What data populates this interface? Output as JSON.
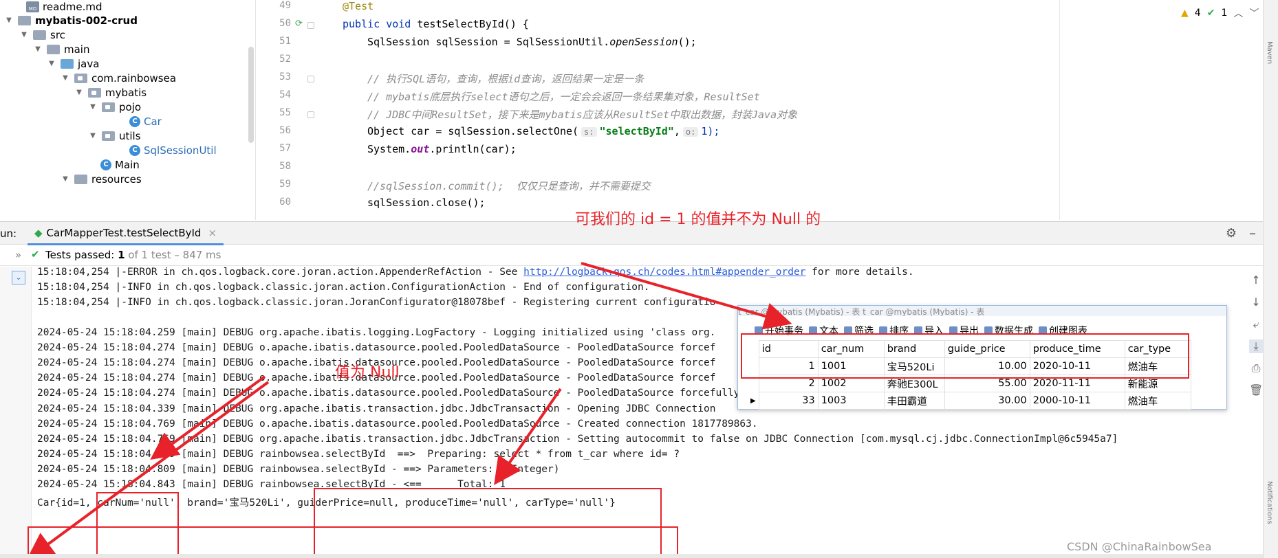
{
  "tree": {
    "readme": "readme.md",
    "module": "mybatis-002-crud",
    "src": "src",
    "main": "main",
    "java": "java",
    "pkg": "com.rainbowsea",
    "mybatis": "mybatis",
    "pojo": "pojo",
    "car": "Car",
    "utils": "utils",
    "sqlutil": "SqlSessionUtil",
    "mainclass": "Main",
    "resources": "resources"
  },
  "editor": {
    "line_numbers": [
      "49",
      "50",
      "51",
      "52",
      "53",
      "54",
      "55",
      "56",
      "57",
      "58",
      "59",
      "60"
    ],
    "annotation": "@Test",
    "l50_kw": "public void",
    "l50_rest": " testSelectById() {",
    "l51_a": "SqlSession sqlSession = SqlSessionUtil.",
    "l51_b": "openSession",
    "l51_c": "();",
    "c53": "// 执行SQL语句，查询，根据id查询，返回结果一定是一条",
    "c54": "// mybatis底层执行select语句之后，一定会会返回一条结果集对象，ResultSet",
    "c55": "// JDBC中间ResultSet，接下来是mybatis应该从ResultSet中取出数据，封装Java对象",
    "l56_a": "Object car = sqlSession.selectOne(",
    "l56_hint1": "s:",
    "l56_str": "\"selectById\"",
    "l56_comma": ",",
    "l56_hint2": "o:",
    "l56_b": "1);",
    "l57_a": "System.",
    "l57_out": "out",
    "l57_b": ".println(car);",
    "c59": "//sqlSession.commit();  仅仅只是查询，并不需要提交",
    "l60": "sqlSession.close();",
    "warn_count": "4",
    "ok_count": "1",
    "maven_label": "Maven",
    "notif_label": "Notifications"
  },
  "run": {
    "label": "un:",
    "tab": "CarMapperTest.testSelectById",
    "status_prefix": "Tests passed:",
    "status_count": "1",
    "status_rest": "of 1 test – 847 ms"
  },
  "log": {
    "l1a": "15:18:04,254 |-ERROR in ch.qos.logback.core.joran.action.AppenderRefAction - See ",
    "l1link": "http://logback.qos.ch/codes.html#appender_order",
    "l1b": " for more details.",
    "l2": "15:18:04,254 |-INFO in ch.qos.logback.classic.joran.action.ConfigurationAction - End of configuration.",
    "l3": "15:18:04,254 |-INFO in ch.qos.logback.classic.joran.JoranConfigurator@18078bef - Registering current configuratio",
    "l4": "2024-05-24 15:18:04.259 [main] DEBUG org.apache.ibatis.logging.LogFactory - Logging initialized using 'class org.",
    "l5": "2024-05-24 15:18:04.274 [main] DEBUG o.apache.ibatis.datasource.pooled.PooledDataSource - PooledDataSource forcef",
    "l6": "2024-05-24 15:18:04.274 [main] DEBUG o.apache.ibatis.datasource.pooled.PooledDataSource - PooledDataSource forcef",
    "l7": "2024-05-24 15:18:04.274 [main] DEBUG o.apache.ibatis.datasource.pooled.PooledDataSource - PooledDataSource forcef",
    "l8": "2024-05-24 15:18:04.274 [main] DEBUG o.apache.ibatis.datasource.pooled.PooledDataSource - PooledDataSource forcefully closed/removed all connections.",
    "l9": "2024-05-24 15:18:04.339 [main] DEBUG org.apache.ibatis.transaction.jdbc.JdbcTransaction - Opening JDBC Connection",
    "l10": "2024-05-24 15:18:04.769 [main] DEBUG o.apache.ibatis.datasource.pooled.PooledDataSource - Created connection 1817789863.",
    "l11": "2024-05-24 15:18:04.769 [main] DEBUG org.apache.ibatis.transaction.jdbc.JdbcTransaction - Setting autocommit to false on JDBC Connection [com.mysql.cj.jdbc.ConnectionImpl@6c5945a7]",
    "l12": "2024-05-24 15:18:04.769 [main] DEBUG rainbowsea.selectById  ==>  Preparing: select * from t_car where id= ?",
    "l13": "2024-05-24 15:18:04.809 [main] DEBUG rainbowsea.selectById - ==> Parameters: 1(Integer)",
    "l14": "2024-05-24 15:18:04.843 [main] DEBUG rainbowsea.selectById - <==      Total: 1",
    "l15": "Car{id=1, carNum='null', brand='宝马520Li', guiderPrice=null, produceTime='null', carType='null'}"
  },
  "db": {
    "title": "t_car @mybatis (Mybatis) - 表        t_car @mybatis (Mybatis) - 表",
    "toolbar": [
      "开始事务",
      "文本",
      "筛选",
      "排序",
      "导入",
      "导出",
      "数据生成",
      "创建图表"
    ],
    "columns": [
      "id",
      "car_num",
      "brand",
      "guide_price",
      "produce_time",
      "car_type"
    ],
    "rows": [
      [
        "1",
        "1001",
        "宝马520Li",
        "10.00",
        "2020-10-11",
        "燃油车"
      ],
      [
        "2",
        "1002",
        "奔驰E300L",
        "55.00",
        "2020-11-11",
        "新能源"
      ],
      [
        "33",
        "1003",
        "丰田霸道",
        "30.00",
        "2000-10-11",
        "燃油车"
      ]
    ]
  },
  "annotations": {
    "top": "可我们的 id = 1 的值并不为 Null 的",
    "left": "值为 Null",
    "color": "#e8222a"
  },
  "watermark": "CSDN @ChinaRainbowSea",
  "colors": {
    "keyword": "#0033b3",
    "string": "#067d17",
    "comment": "#8c8c8c",
    "annotation": "#9e880d",
    "accent": "#4d90d8",
    "pass": "#2fa84f"
  }
}
